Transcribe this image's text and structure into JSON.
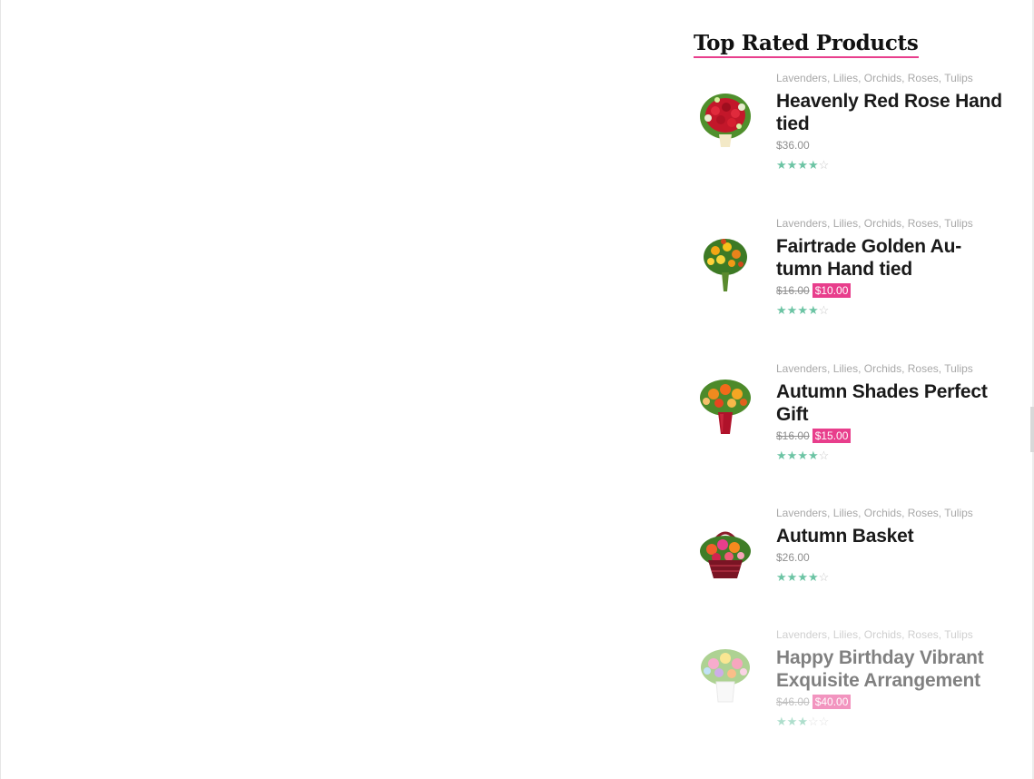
{
  "widget": {
    "title": "Top Rated Products"
  },
  "colors": {
    "accent_pink": "#e83e8c",
    "star_green": "#6cc4a4",
    "category_gray": "#a8a8a8"
  },
  "products": [
    {
      "categories": [
        "Lavenders",
        "Lilies",
        "Orchids",
        "Roses",
        "Tulips"
      ],
      "name": "Heavenly Red Rose Hand tied",
      "price": "$36.00",
      "regular_price": "",
      "sale_price": "",
      "rating": 4,
      "image_icon": "red-rose-bouquet-image"
    },
    {
      "categories": [
        "Lavenders",
        "Lilies",
        "Orchids",
        "Roses",
        "Tulips"
      ],
      "name": "Fairtrade Golden Au-tumn Hand tied",
      "price": "",
      "regular_price": "$16.00",
      "sale_price": "$10.00",
      "rating": 4,
      "image_icon": "golden-bouquet-image"
    },
    {
      "categories": [
        "Lavenders",
        "Lilies",
        "Orchids",
        "Roses",
        "Tulips"
      ],
      "name": "Autumn Shades Perfect Gift",
      "price": "",
      "regular_price": "$16.00",
      "sale_price": "$15.00",
      "rating": 4,
      "image_icon": "autumn-vase-image"
    },
    {
      "categories": [
        "Lavenders",
        "Lilies",
        "Orchids",
        "Roses",
        "Tulips"
      ],
      "name": "Autumn Basket",
      "price": "$26.00",
      "regular_price": "",
      "sale_price": "",
      "rating": 4,
      "image_icon": "flower-basket-image"
    },
    {
      "categories": [
        "Lavenders",
        "Lilies",
        "Orchids",
        "Roses",
        "Tulips"
      ],
      "name": "Happy Birthday Vibrant Exquisite Arrangement",
      "price": "",
      "regular_price": "$46.00",
      "sale_price": "$40.00",
      "rating": 3,
      "image_icon": "birthday-arrangement-image"
    }
  ]
}
